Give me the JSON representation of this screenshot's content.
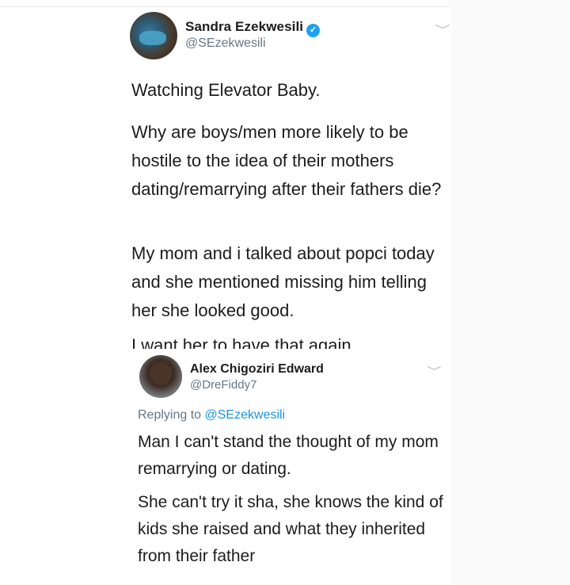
{
  "tweet": {
    "author_name": "Sandra Ezekwesili",
    "author_handle": "@SEzekwesili",
    "verified_glyph": "✓",
    "chevron": "﹀",
    "paragraphs": [
      "Watching Elevator Baby.",
      "Why are boys/men more likely to be hostile to the idea of their mothers dating/remarrying after their fathers die?",
      "My mom and i talked about popci today and she mentioned missing him telling her she looked good.",
      "I want her to have that again."
    ]
  },
  "reply": {
    "author_name": "Alex Chigoziri Edward",
    "author_handle": "@DreFiddy7",
    "chevron": "﹀",
    "replying_prefix": "Replying to",
    "replying_mention": "@SEzekwesili",
    "paragraphs": [
      "Man I can't stand the thought of my mom remarrying or dating.",
      "She can't try it sha, she knows the kind of kids she raised and what they inherited from their father"
    ]
  },
  "colors": {
    "text": "#1c1c1c",
    "secondary": "#657786",
    "link": "#1b95e0",
    "verified": "#1da1f2"
  }
}
